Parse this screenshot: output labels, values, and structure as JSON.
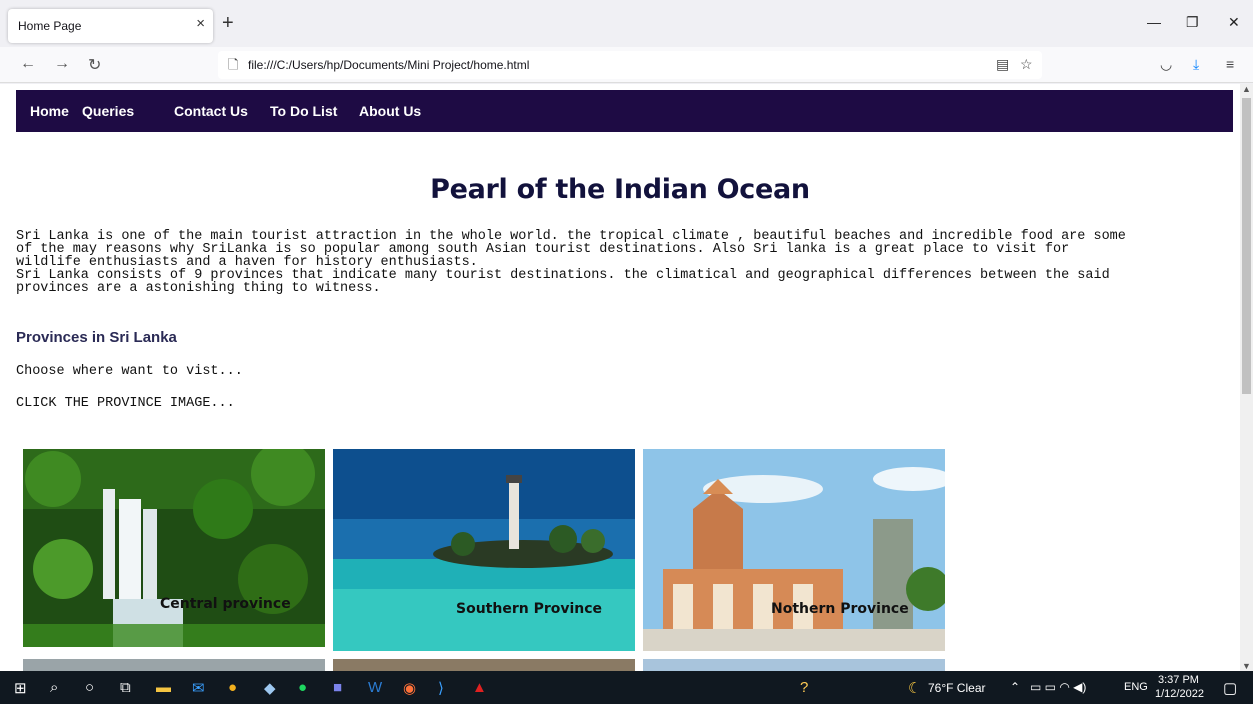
{
  "browser": {
    "tab_title": "Home Page",
    "tab_close": "×",
    "new_tab": "+",
    "url": "file:///C:/Users/hp/Documents/Mini Project/home.html"
  },
  "site": {
    "nav": [
      "Home",
      "Queries",
      "Contact Us",
      "To Do List",
      "About Us"
    ],
    "headline": "Pearl of the Indian Ocean",
    "intro_lines": [
      "Sri Lanka is one of the main tourist attraction in the whole world. the tropical climate , beautiful beaches and incredible food are some",
      "of the may reasons why SriLanka is so popular among south Asian tourist destinations. Also Sri lanka is a great place to visit for",
      "wildlife enthusiasts and a haven for history enthusiasts.",
      "Sri Lanka consists of 9 provinces that indicate many tourist destinations. the climatical and geographical differences between the said",
      "provinces are a astonishing thing to witness."
    ],
    "provinces_heading": "Provinces in Sri Lanka",
    "choose_text": "Choose where want to vist...",
    "click_text": "CLICK THE PROVINCE IMAGE...",
    "cards": [
      {
        "label": "Central province"
      },
      {
        "label": "Southern Province"
      },
      {
        "label": "Nothern Province"
      }
    ]
  },
  "taskbar": {
    "weather": "76°F Clear",
    "lang": "ENG",
    "time": "3:37 PM",
    "date": "1/12/2022"
  },
  "colors": {
    "site_nav": "#1e0b44",
    "headline": "#12123c",
    "taskbar": "#101820"
  }
}
